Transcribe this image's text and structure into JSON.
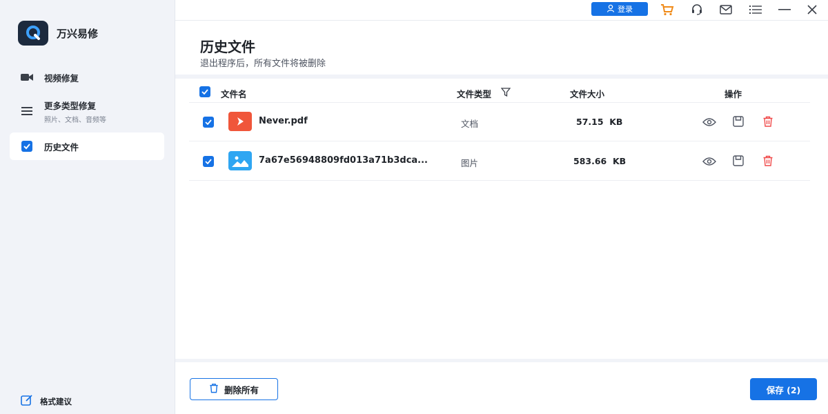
{
  "app": {
    "name": "万兴易修"
  },
  "sidebar": {
    "items": [
      {
        "label": "视频修复",
        "sub": ""
      },
      {
        "label": "更多类型修复",
        "sub": "照片、文档、音频等"
      },
      {
        "label": "历史文件",
        "sub": ""
      }
    ],
    "feedback_label": "格式建议"
  },
  "titlebar": {
    "login_label": "登录",
    "icons": [
      "user-icon",
      "cart-icon",
      "headset-icon",
      "mail-icon",
      "menu-icon",
      "minimize-icon",
      "close-icon"
    ]
  },
  "page": {
    "title": "历史文件",
    "subtitle": "退出程序后，所有文件将被删除"
  },
  "table": {
    "headers": {
      "name": "文件名",
      "type": "文件类型",
      "size": "文件大小",
      "actions": "操作"
    },
    "rows": [
      {
        "name": "Never.pdf",
        "type": "文档",
        "size": "57.15  KB",
        "checked": true,
        "thumb": "pdf"
      },
      {
        "name": "7a67e56948809fd013a71b3dca...",
        "type": "图片",
        "size": "583.66  KB",
        "checked": true,
        "thumb": "image"
      }
    ]
  },
  "footer": {
    "delete_all_label": "删除所有",
    "save_label": "保存 (2)"
  },
  "colors": {
    "accent": "#1672e5",
    "pdf": "#f0563a",
    "image": "#2fa6f2",
    "danger": "#f04848",
    "cart": "#f08a18"
  }
}
